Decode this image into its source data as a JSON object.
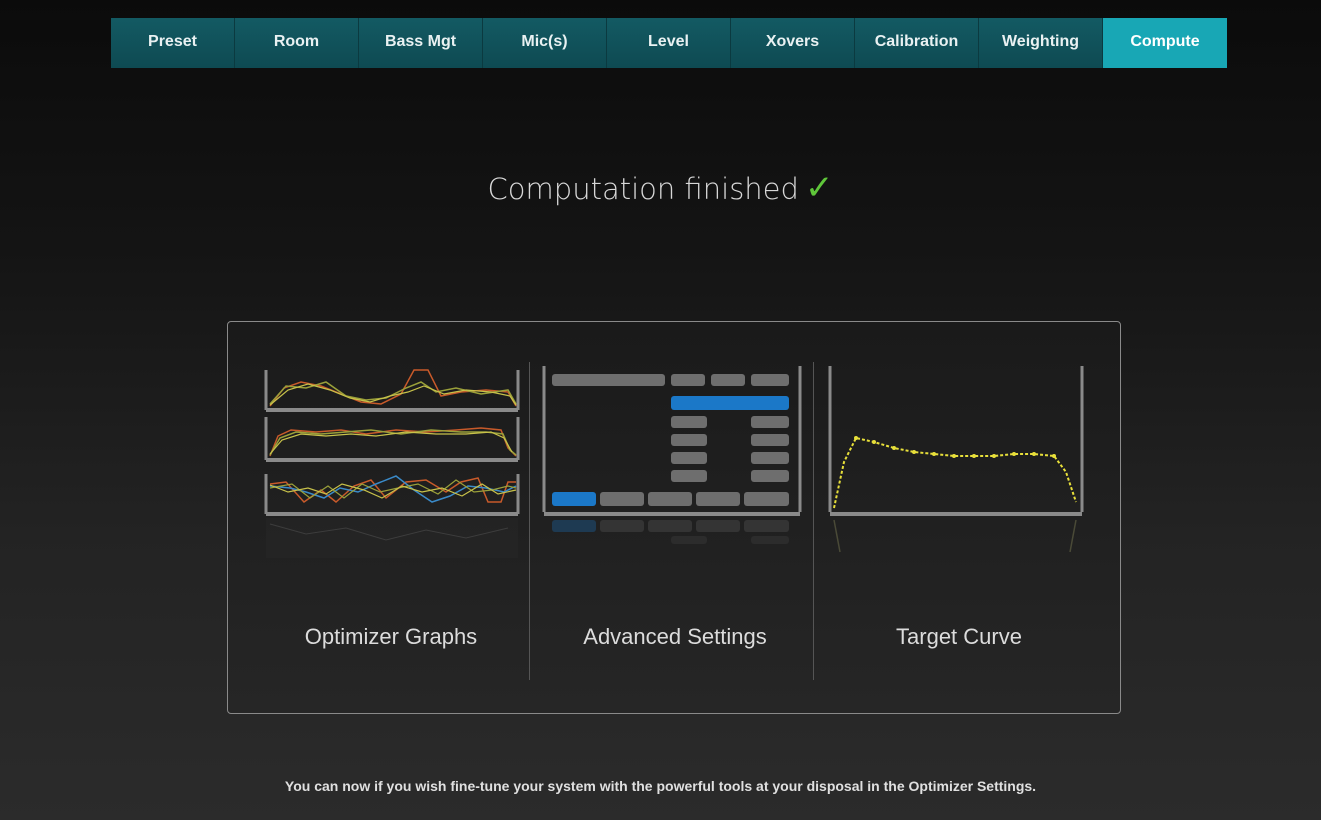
{
  "tabs": [
    {
      "label": "Preset"
    },
    {
      "label": "Room"
    },
    {
      "label": "Bass Mgt"
    },
    {
      "label": "Mic(s)"
    },
    {
      "label": "Level"
    },
    {
      "label": "Xovers"
    },
    {
      "label": "Calibration"
    },
    {
      "label": "Weighting"
    },
    {
      "label": "Compute",
      "active": true
    }
  ],
  "status": {
    "title": "Computation finished",
    "check_icon": "checkmark-icon",
    "check_color": "#5fc63a"
  },
  "options": {
    "optimizer_graphs": "Optimizer Graphs",
    "advanced_settings": "Advanced Settings",
    "target_curve": "Target Curve"
  },
  "footer": {
    "text": "You can now if you wish fine-tune your system with the powerful tools at your disposal in the Optimizer Settings."
  },
  "colors": {
    "tab_active": "#18a7b5",
    "tab_inactive": "#135a63",
    "accent_blue": "#1b78c8",
    "curve_yellow": "#e8e03a"
  }
}
